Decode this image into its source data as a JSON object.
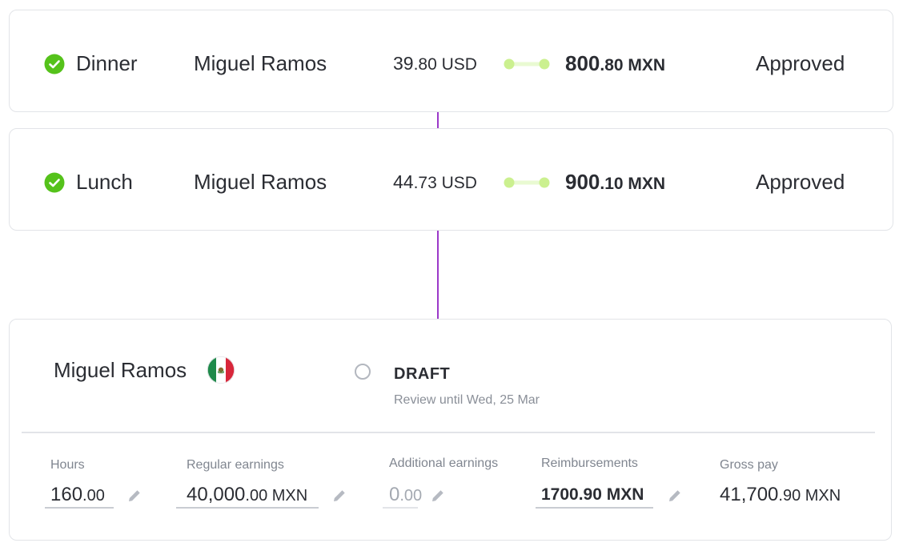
{
  "expenses": [
    {
      "category": "Dinner",
      "employee": "Miguel Ramos",
      "amount_usd_int": "39",
      "amount_usd_dec": ".80",
      "amount_usd_cur": " USD",
      "amount_mxn_int": "800",
      "amount_mxn_dec": ".80",
      "amount_mxn_cur": " MXN",
      "status": "Approved"
    },
    {
      "category": "Lunch",
      "employee": "Miguel Ramos",
      "amount_usd_int": "44",
      "amount_usd_dec": ".73",
      "amount_usd_cur": " USD",
      "amount_mxn_int": "900",
      "amount_mxn_dec": ".10",
      "amount_mxn_cur": " MXN",
      "status": "Approved"
    }
  ],
  "payroll": {
    "employee": "Miguel Ramos",
    "country_flag_icon": "mexico-flag-icon",
    "status": "DRAFT",
    "review_note": "Review until Wed, 25 Mar",
    "fields": {
      "hours": {
        "label": "Hours",
        "int": "160",
        "dec": ".00",
        "cur": ""
      },
      "regular": {
        "label": "Regular earnings",
        "int": "40,000",
        "dec": ".00",
        "cur": " MXN"
      },
      "additional": {
        "label": "Additional earnings",
        "int": "0",
        "dec": ".00",
        "cur": ""
      },
      "reimbursements": {
        "label": "Reimbursements",
        "value": "1700.90 MXN"
      },
      "gross": {
        "label": "Gross pay",
        "int": "41,700",
        "dec": ".90",
        "cur": " MXN"
      }
    }
  },
  "colors": {
    "approved_check": "#55c21b",
    "connector": "#9b38c9",
    "fx_link": "#d6f5a6",
    "mx_green": "#1f8a4a",
    "mx_red": "#d8263a"
  }
}
